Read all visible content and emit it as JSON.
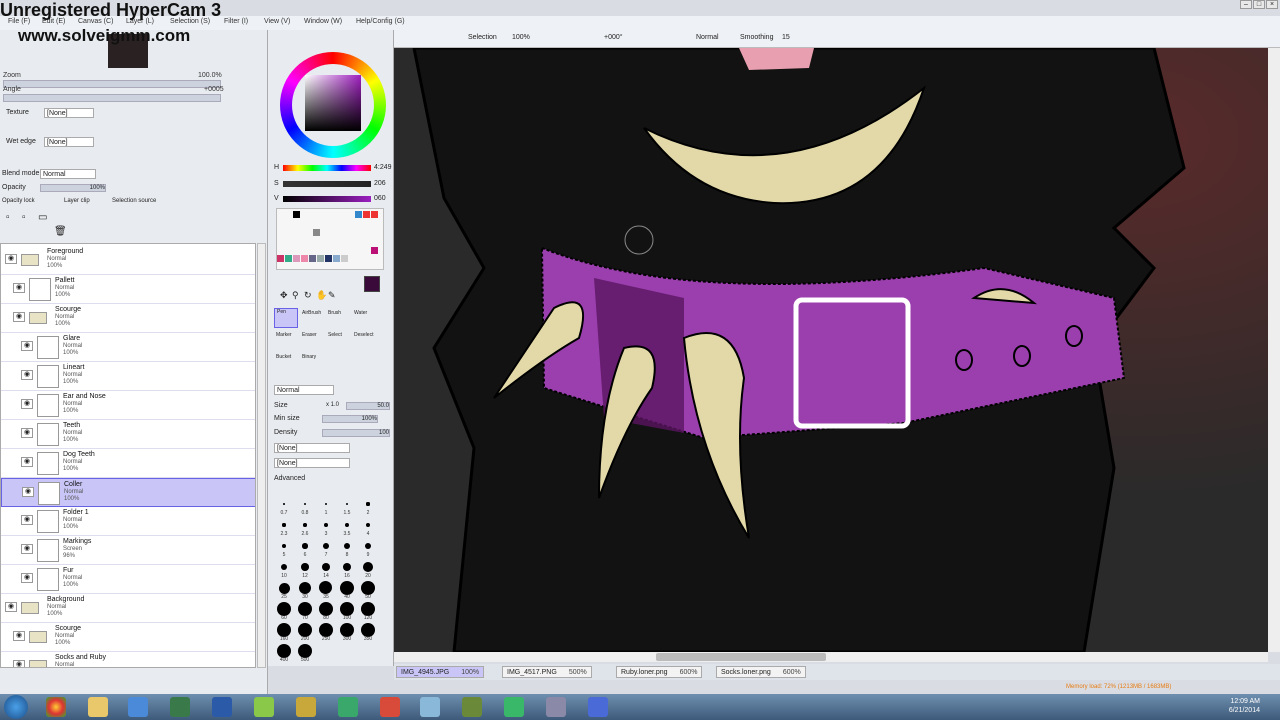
{
  "watermark": {
    "title": "Unregistered HyperCam 3",
    "url": "www.solveigmm.com"
  },
  "menu": [
    "File (F)",
    "Edit (E)",
    "Canvas (C)",
    "Layer (L)",
    "Selection (S)",
    "Filter (I)",
    "View (V)",
    "Window (W)",
    "Help/Config (G)"
  ],
  "navigator": {
    "zoom_label": "Zoom",
    "zoom_value": "100.0%",
    "angle_label": "Angle",
    "angle_value": "+0005"
  },
  "brush_settings": {
    "texture_label": "Texture",
    "texture_value": "[None]",
    "wet_edge_label": "Wet edge",
    "wet_edge_value": "[None]",
    "blend_mode_label": "Blend mode",
    "blend_mode_value": "Normal",
    "opacity_label": "Opacity",
    "opacity_value": "100%",
    "opacity_lock": "Opacity lock",
    "layer_clip": "Layer clip",
    "selection_source": "Selection source"
  },
  "layers": [
    {
      "name": "Foreground",
      "mode": "Normal",
      "opacity": "100%",
      "type": "folder",
      "indent": 0
    },
    {
      "name": "Pallett",
      "mode": "Normal",
      "opacity": "100%",
      "type": "layer",
      "indent": 1
    },
    {
      "name": "Scourge",
      "mode": "Normal",
      "opacity": "100%",
      "type": "folder",
      "indent": 1
    },
    {
      "name": "Glare",
      "mode": "Normal",
      "opacity": "100%",
      "type": "layer",
      "indent": 2
    },
    {
      "name": "Lineart",
      "mode": "Normal",
      "opacity": "100%",
      "type": "layer",
      "indent": 2
    },
    {
      "name": "Ear and Nose",
      "mode": "Normal",
      "opacity": "100%",
      "type": "layer",
      "indent": 2
    },
    {
      "name": "Teeth",
      "mode": "Normal",
      "opacity": "100%",
      "type": "layer",
      "indent": 2
    },
    {
      "name": "Dog Teeth",
      "mode": "Normal",
      "opacity": "100%",
      "type": "layer",
      "indent": 2
    },
    {
      "name": "Coller",
      "mode": "Normal",
      "opacity": "100%",
      "type": "layer",
      "indent": 2,
      "selected": true
    },
    {
      "name": "Folder 1",
      "mode": "Normal",
      "opacity": "100%",
      "type": "layer",
      "indent": 2
    },
    {
      "name": "Markings",
      "mode": "Screen",
      "opacity": "96%",
      "type": "layer",
      "indent": 2
    },
    {
      "name": "Fur",
      "mode": "Normal",
      "opacity": "100%",
      "type": "layer",
      "indent": 2
    },
    {
      "name": "Background",
      "mode": "Normal",
      "opacity": "100%",
      "type": "folder",
      "indent": 0
    },
    {
      "name": "Scourge",
      "mode": "Normal",
      "opacity": "100%",
      "type": "folder",
      "indent": 1
    },
    {
      "name": "Socks and Ruby",
      "mode": "Normal",
      "opacity": "100%",
      "type": "folder",
      "indent": 1
    }
  ],
  "color": {
    "h_label": "H",
    "h_value": "4:249",
    "s_label": "S",
    "s_value": "206",
    "v_label": "V",
    "v_value": "060",
    "current": "#3a0a3a"
  },
  "tools": {
    "row1": [
      "Pen",
      "AirBrush",
      "Brush",
      "Water"
    ],
    "row2": [
      "Marker",
      "Eraser",
      "Select",
      "Deselect"
    ],
    "row3": [
      "Bucket",
      "Binary"
    ]
  },
  "tool_settings": {
    "mode": "Normal",
    "size_label": "Size",
    "size_mult": "x 1.0",
    "size_value": "50.0",
    "min_size_label": "Min size",
    "min_size_value": "100%",
    "density_label": "Density",
    "density_value": "100",
    "texture1": "[None]",
    "texture2": "[None]",
    "advanced": "Advanced"
  },
  "brush_sizes": [
    "0.7",
    "0.8",
    "1",
    "1.5",
    "2",
    "2.3",
    "2.6",
    "3",
    "3.5",
    "4",
    "5",
    "6",
    "7",
    "8",
    "9",
    "10",
    "12",
    "14",
    "16",
    "20",
    "25",
    "30",
    "35",
    "40",
    "50",
    "60",
    "70",
    "80",
    "100",
    "120",
    "160",
    "200",
    "250",
    "300",
    "350",
    "400",
    "500"
  ],
  "canvas_toolbar": {
    "selection": "Selection",
    "zoom": "100%",
    "angle": "+000°",
    "blend": "Normal",
    "smoothing_label": "Smoothing",
    "smoothing_value": "15"
  },
  "doc_tabs": [
    {
      "name": "IMG_4945.JPG",
      "zoom": "100%",
      "active": true
    },
    {
      "name": "IMG_4517.PNG",
      "zoom": "500%"
    },
    {
      "name": "Ruby.loner.png",
      "zoom": "600%"
    },
    {
      "name": "Socks.loner.png",
      "zoom": "600%"
    }
  ],
  "status": {
    "memory": "Memory load: 72% (1213MB / 1683MB)",
    "time": "12:09 AM",
    "date": "6/21/2014"
  },
  "colors": {
    "collar": "#9b3fae",
    "teeth": "#e3d9a8",
    "fur": "#111111",
    "selected_layer": "#c9c6f7"
  }
}
